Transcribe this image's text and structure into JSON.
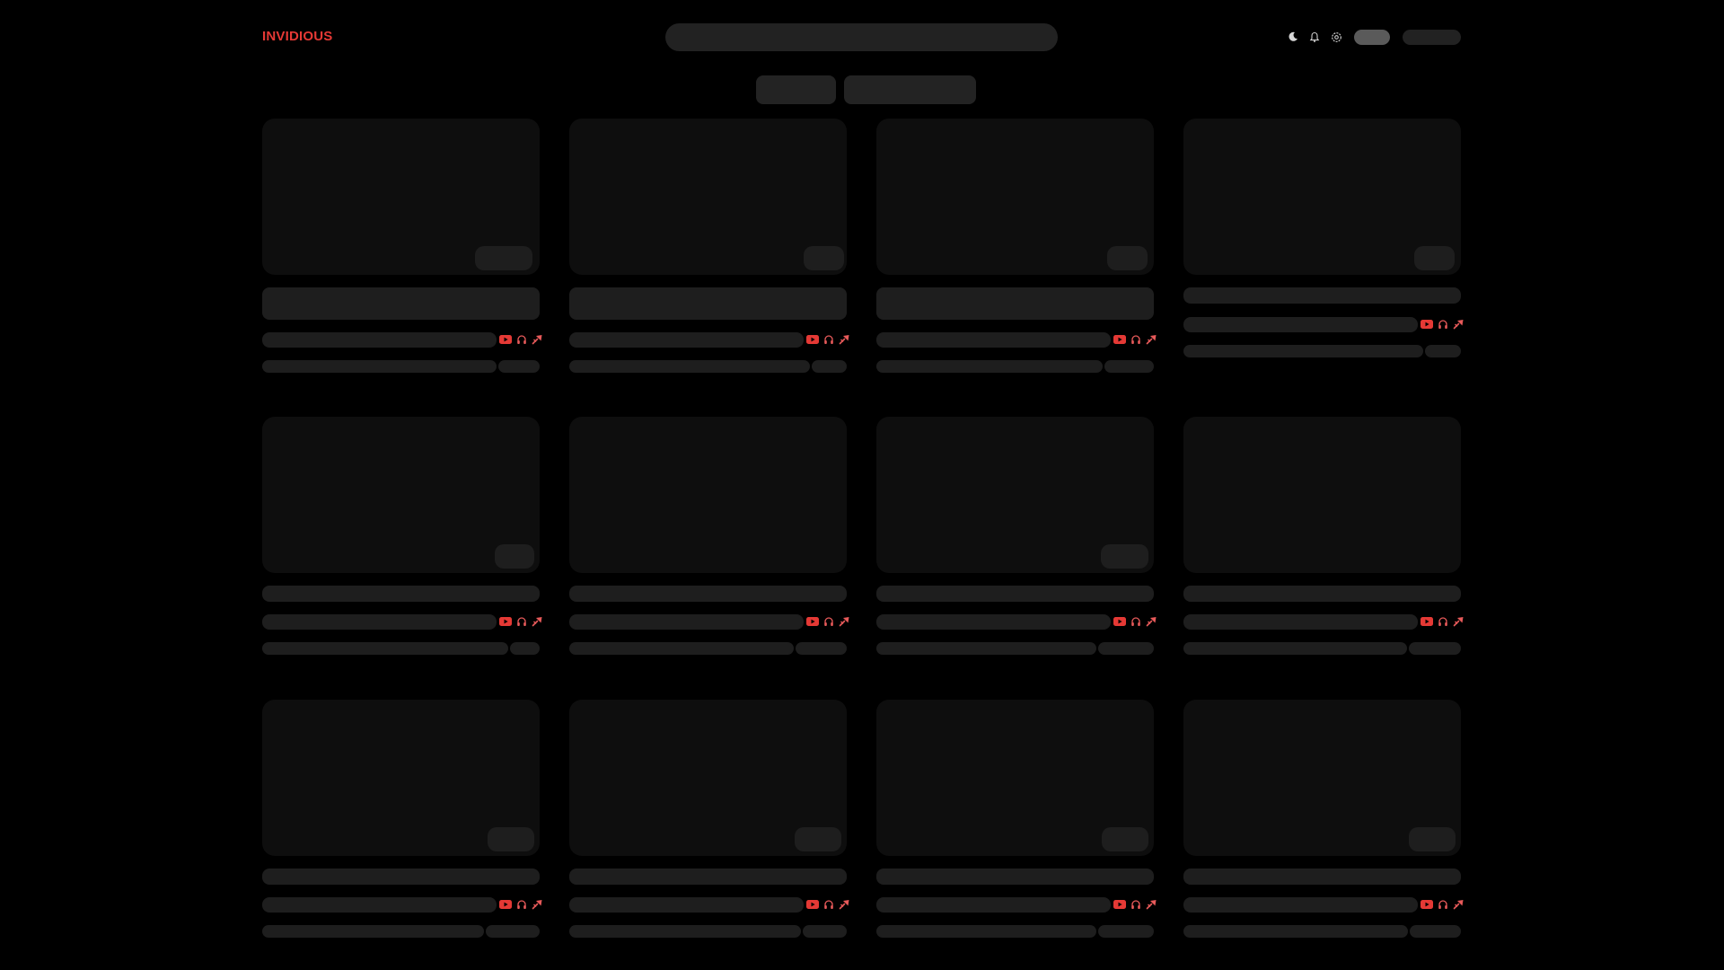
{
  "header": {
    "logo": "INVIDIOUS",
    "search": {
      "value": "",
      "placeholder": ""
    },
    "icons": [
      "moon-icon",
      "bell-icon",
      "gear-icon"
    ],
    "buttons": [
      {
        "label": "",
        "name": "account-pill-button"
      },
      {
        "label": "",
        "name": "user-menu-button"
      }
    ]
  },
  "tabs": [
    {
      "label": ""
    },
    {
      "label": ""
    }
  ],
  "colors": {
    "accent": "#e53935",
    "background": "#000000",
    "placeholder": "#1e1e1e"
  },
  "cards": [
    {
      "title": "",
      "channel": "",
      "views": "",
      "published": "",
      "duration": ""
    },
    {
      "title": "",
      "channel": "",
      "views": "",
      "published": "",
      "duration": ""
    },
    {
      "title": "",
      "channel": "",
      "views": "",
      "published": "",
      "duration": ""
    },
    {
      "title": "",
      "channel": "",
      "views": "",
      "published": "",
      "duration": ""
    },
    {
      "title": "",
      "channel": "",
      "views": "",
      "published": "",
      "duration": ""
    },
    {
      "title": "",
      "channel": "",
      "views": "",
      "published": "",
      "duration": ""
    },
    {
      "title": "",
      "channel": "",
      "views": "",
      "published": "",
      "duration": ""
    },
    {
      "title": "",
      "channel": "",
      "views": "",
      "published": "",
      "duration": ""
    },
    {
      "title": "",
      "channel": "",
      "views": "",
      "published": "",
      "duration": ""
    },
    {
      "title": "",
      "channel": "",
      "views": "",
      "published": "",
      "duration": ""
    },
    {
      "title": "",
      "channel": "",
      "views": "",
      "published": "",
      "duration": ""
    },
    {
      "title": "",
      "channel": "",
      "views": "",
      "published": "",
      "duration": ""
    }
  ],
  "card_action_icons": [
    "youtube-icon",
    "headphones-icon",
    "redirect-icon"
  ]
}
